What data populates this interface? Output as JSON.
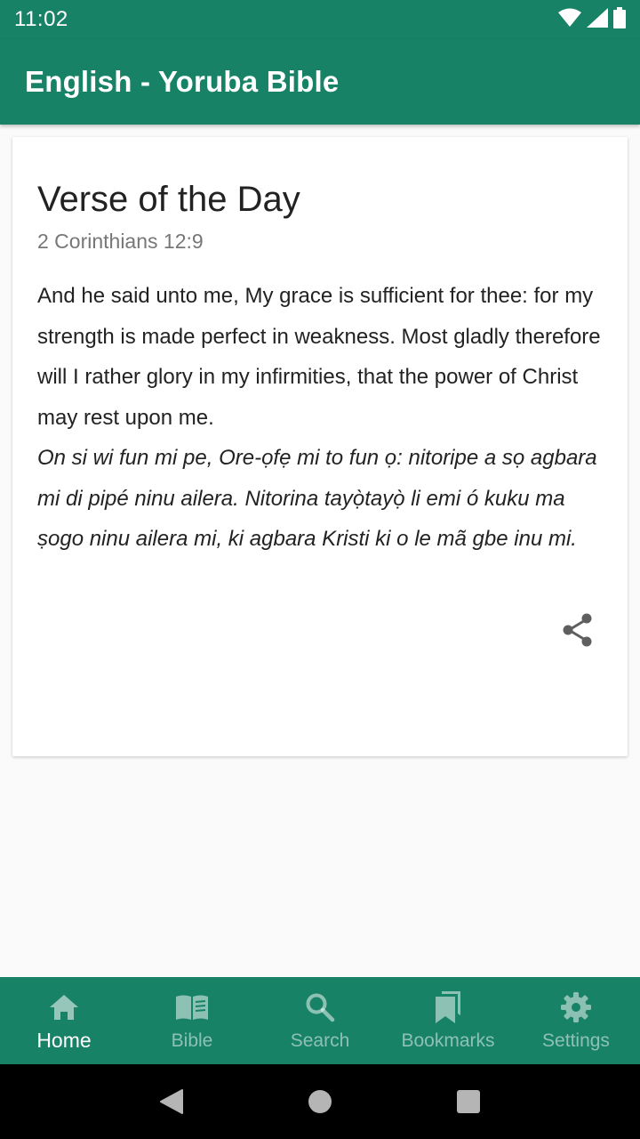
{
  "status_bar": {
    "time": "11:02",
    "icons": [
      "wifi-icon",
      "signal-icon",
      "battery-icon"
    ]
  },
  "app_bar": {
    "title": "English - Yoruba Bible"
  },
  "card": {
    "title": "Verse of the Day",
    "reference": "2 Corinthians 12:9",
    "verse_english": "And he said unto me, My grace is sufficient for thee: for my strength is made perfect in weakness. Most gladly therefore will I rather glory in my infirmities, that the power of Christ may rest upon me.",
    "verse_yoruba": "On si wi fun mi pe, Ore-ọfẹ mi to fun ọ: nitoripe a sọ agbara mi di pipé ninu ailera. Nitorina tayọ̀tayọ̀ li emi ó kuku ma ṣogo ninu ailera mi, ki agbara Kristi ki o le mã gbe inu mi.",
    "share_icon": "share-icon"
  },
  "bottom_nav": {
    "items": [
      {
        "label": "Home",
        "icon": "home-icon",
        "active": true
      },
      {
        "label": "Bible",
        "icon": "book-icon",
        "active": false
      },
      {
        "label": "Search",
        "icon": "search-icon",
        "active": false
      },
      {
        "label": "Bookmarks",
        "icon": "bookmarks-icon",
        "active": false
      },
      {
        "label": "Settings",
        "icon": "gear-icon",
        "active": false
      }
    ]
  },
  "system_nav": {
    "buttons": [
      "back-icon",
      "home-circle-icon",
      "recents-icon"
    ]
  },
  "colors": {
    "primary": "#188267",
    "background": "#fafafa",
    "card": "#ffffff",
    "secondary_text": "#777777"
  }
}
